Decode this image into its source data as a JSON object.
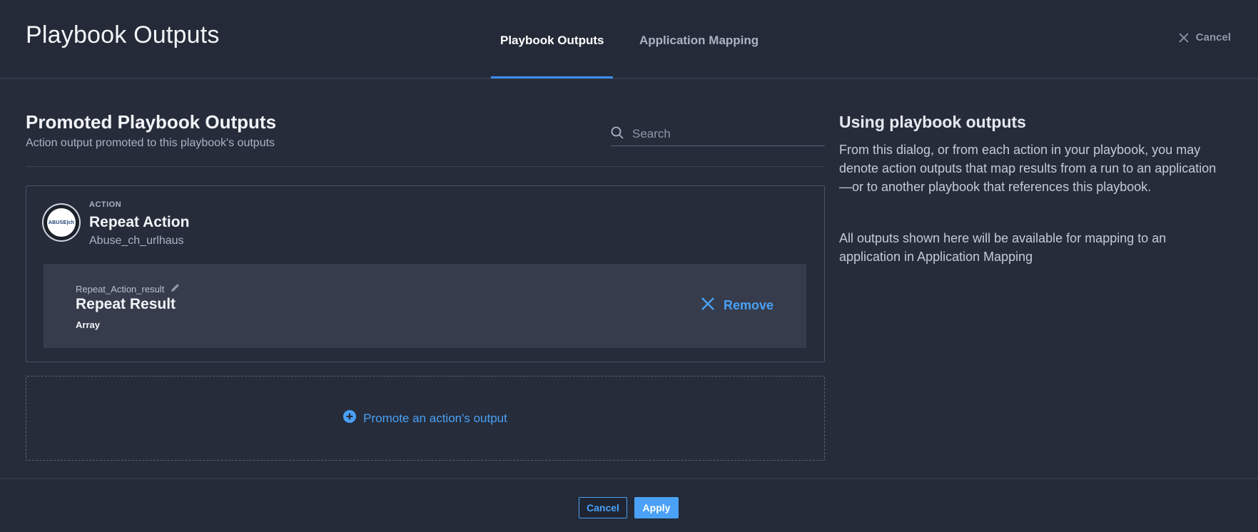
{
  "header": {
    "title": "Playbook Outputs",
    "tabs": [
      {
        "label": "Playbook Outputs",
        "active": true
      },
      {
        "label": "Application Mapping",
        "active": false
      }
    ],
    "cancel_label": "Cancel"
  },
  "main": {
    "section_title": "Promoted Playbook Outputs",
    "section_subtitle": "Action output promoted to this playbook's outputs",
    "search": {
      "placeholder": "Search",
      "value": ""
    },
    "action": {
      "tag": "ACTION",
      "name": "Repeat Action",
      "source": "Abuse_ch_urlhaus",
      "logo_text": "ABUSE|ch",
      "output": {
        "key": "Repeat_Action_result",
        "title": "Repeat Result",
        "type": "Array",
        "remove_label": "Remove"
      }
    },
    "promote_label": "Promote an action's output"
  },
  "help": {
    "title": "Using playbook outputs",
    "paragraph1": "From this dialog, or from each action in your playbook, you may denote action outputs that map results from a run to an application—or to another playbook that references this playbook.",
    "paragraph2": "All outputs shown here will be available for mapping to an application in Application Mapping"
  },
  "footer": {
    "cancel_label": "Cancel",
    "apply_label": "Apply"
  },
  "colors": {
    "background": "#262c3a",
    "accent": "#4aa1f5",
    "tab_underline": "#3a8ef0"
  }
}
